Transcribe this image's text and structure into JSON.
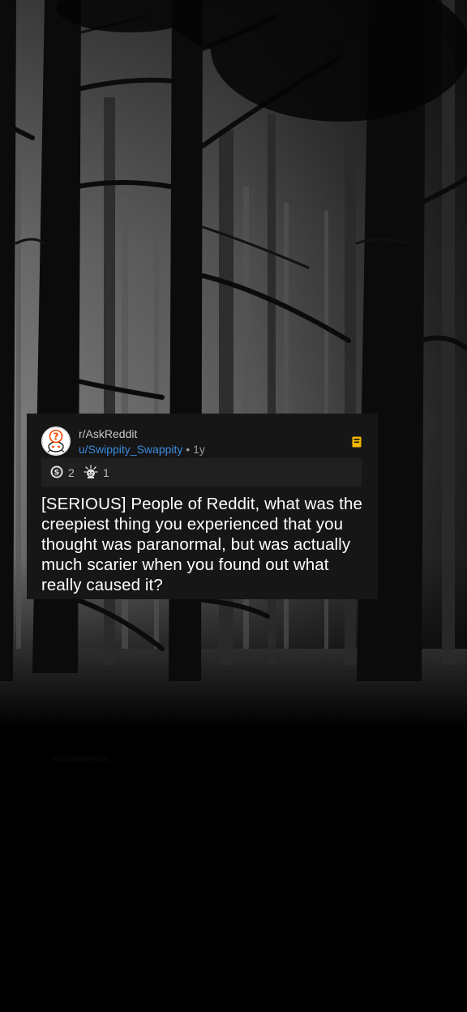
{
  "post": {
    "subreddit": "r/AskReddit",
    "username": "u/Swippity_Swappity",
    "separator": "•",
    "age": "1y",
    "title": "[SERIOUS] People of Reddit, what was the creepiest thing you experienced that you thought was paranormal, but was actually much scarier when you found out what really caused it?",
    "avatar_icon": "reddit-alien-question-icon",
    "save_icon": "save-bookmark-icon"
  },
  "awards": [
    {
      "icon": "silver-award-icon",
      "count": "2"
    },
    {
      "icon": "wholesome-award-icon",
      "count": "1"
    }
  ],
  "colors": {
    "card_bg": "#161616",
    "award_bar_bg": "#202020",
    "username": "#3b8cdf",
    "save_icon": "#f5b800",
    "title": "#ffffff"
  }
}
